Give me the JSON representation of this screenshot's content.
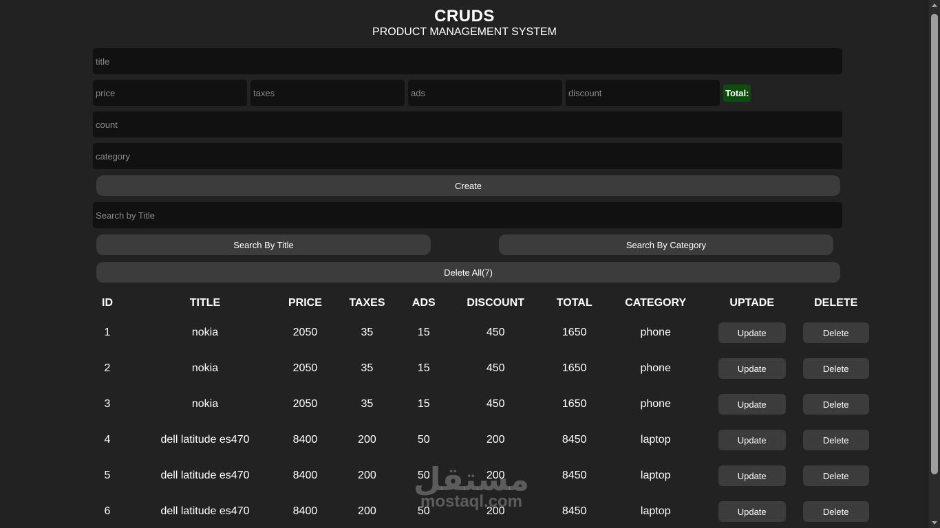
{
  "header": {
    "title": "CRUDS",
    "subtitle": "PRODUCT MANAGEMENT SYSTEM"
  },
  "form": {
    "title_placeholder": "title",
    "price_placeholder": "price",
    "taxes_placeholder": "taxes",
    "ads_placeholder": "ads",
    "discount_placeholder": "discount",
    "total_label": "Total:",
    "count_placeholder": "count",
    "category_placeholder": "category",
    "create_label": "Create"
  },
  "search": {
    "placeholder": "Search by Title",
    "by_title_label": "Search By Title",
    "by_category_label": "Search By Category",
    "delete_all_label": "Delete All(7)"
  },
  "table": {
    "headers": [
      "ID",
      "TITLE",
      "PRICE",
      "TAXES",
      "ADS",
      "DISCOUNT",
      "TOTAL",
      "CATEGORY",
      "UPTADE",
      "DELETE"
    ],
    "update_label": "Update",
    "delete_label": "Delete",
    "rows": [
      [
        "1",
        "nokia",
        "2050",
        "35",
        "15",
        "450",
        "1650",
        "phone"
      ],
      [
        "2",
        "nokia",
        "2050",
        "35",
        "15",
        "450",
        "1650",
        "phone"
      ],
      [
        "3",
        "nokia",
        "2050",
        "35",
        "15",
        "450",
        "1650",
        "phone"
      ],
      [
        "4",
        "dell latitude es470",
        "8400",
        "200",
        "50",
        "200",
        "8450",
        "laptop"
      ],
      [
        "5",
        "dell latitude es470",
        "8400",
        "200",
        "50",
        "200",
        "8450",
        "laptop"
      ],
      [
        "6",
        "dell latitude es470",
        "8400",
        "200",
        "50",
        "200",
        "8450",
        "laptop"
      ]
    ]
  },
  "watermark": {
    "arabic": "مستقل",
    "latin": "mostaql.com"
  },
  "colors": {
    "background": "#222222",
    "input": "#111111",
    "button": "#3c3c3c",
    "total_badge": "#0b4d0b"
  }
}
